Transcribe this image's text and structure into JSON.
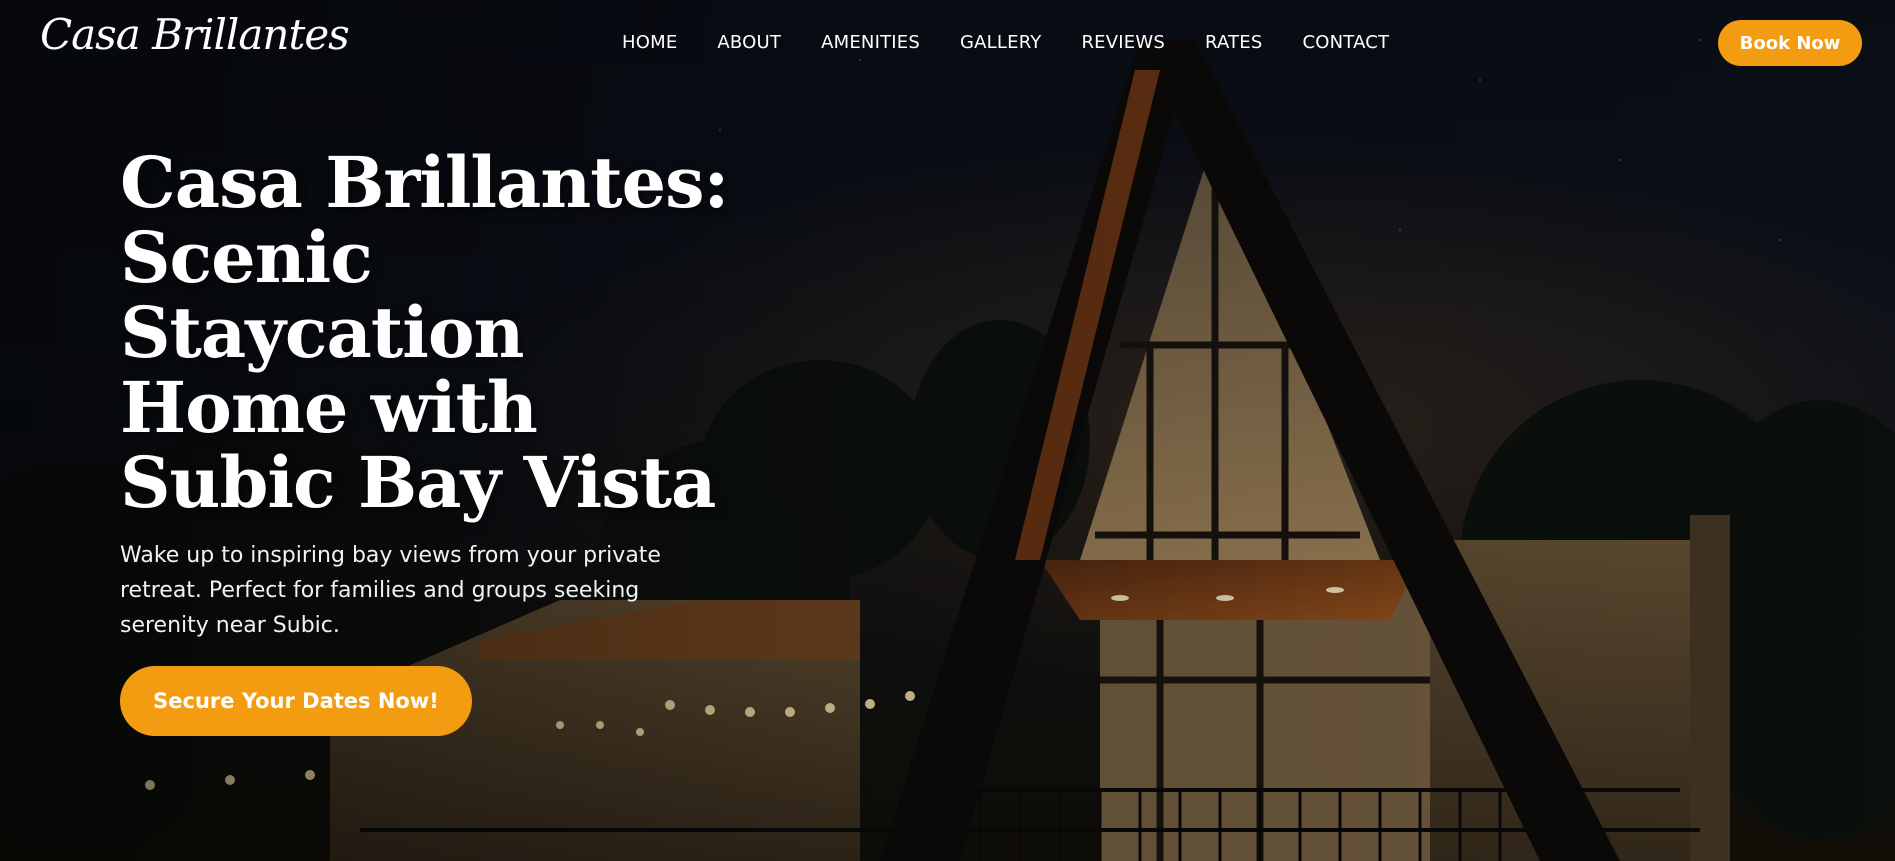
{
  "nav": {
    "logo": "Casa Brillantes",
    "menu": [
      {
        "label": "HOME"
      },
      {
        "label": "ABOUT"
      },
      {
        "label": "AMENITIES"
      },
      {
        "label": "GALLERY"
      },
      {
        "label": "REVIEWS"
      },
      {
        "label": "RATES"
      },
      {
        "label": "CONTACT"
      }
    ],
    "book_label": "Book Now"
  },
  "hero": {
    "title": "Casa Brillantes: Scenic Staycation Home with Subic Bay Vista",
    "subtitle": "Wake up to inspiring bay views from your private retreat. Perfect for families and groups seeking serenity near Subic.",
    "cta_label": "Secure Your Dates Now!"
  },
  "colors": {
    "accent": "#f39c12",
    "background": "#0b0f18",
    "text": "#ffffff"
  }
}
